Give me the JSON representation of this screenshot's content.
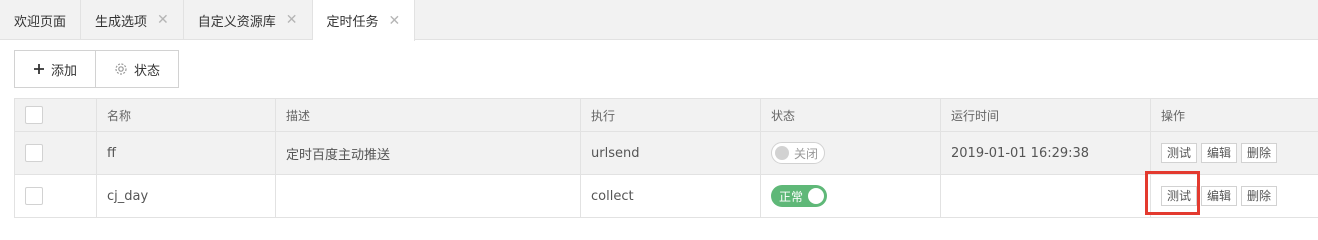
{
  "tabs": [
    {
      "label": "欢迎页面",
      "closable": false
    },
    {
      "label": "生成选项",
      "closable": true
    },
    {
      "label": "自定义资源库",
      "closable": true
    },
    {
      "label": "定时任务",
      "closable": true,
      "active": true
    }
  ],
  "toolbar": {
    "add_label": "添加",
    "status_label": "状态"
  },
  "table": {
    "columns": [
      "名称",
      "描述",
      "执行",
      "状态",
      "运行时间",
      "操作"
    ],
    "rows": [
      {
        "name": "ff",
        "desc": "定时百度主动推送",
        "exec": "urlsend",
        "status": "关闭",
        "status_on": false,
        "runtime": "2019-01-01 16:29:38"
      },
      {
        "name": "cj_day",
        "desc": "",
        "exec": "collect",
        "status": "正常",
        "status_on": true,
        "runtime": ""
      }
    ],
    "actions": {
      "test": "测试",
      "edit": "编辑",
      "delete": "删除"
    }
  },
  "colors": {
    "switch_on": "#5fb878",
    "highlight": "#e33a2f"
  }
}
